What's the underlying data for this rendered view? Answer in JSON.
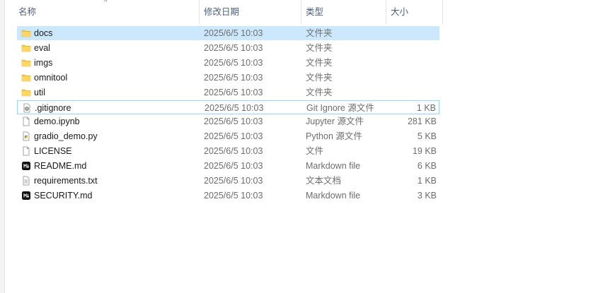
{
  "columns": {
    "name": "名称",
    "modified": "修改日期",
    "type": "类型",
    "size": "大小",
    "sort_indicator": "^"
  },
  "colors": {
    "folder": "#f5c542",
    "selection": "#cce8ff",
    "header_text": "#4c607a",
    "secondary_text": "#6d6d6d"
  },
  "files": [
    {
      "name": "docs",
      "modified": "2025/6/5 10:03",
      "type": "文件夹",
      "size": "",
      "icon": "folder-icon",
      "state": "selected"
    },
    {
      "name": "eval",
      "modified": "2025/6/5 10:03",
      "type": "文件夹",
      "size": "",
      "icon": "folder-icon",
      "state": ""
    },
    {
      "name": "imgs",
      "modified": "2025/6/5 10:03",
      "type": "文件夹",
      "size": "",
      "icon": "folder-icon",
      "state": ""
    },
    {
      "name": "omnitool",
      "modified": "2025/6/5 10:03",
      "type": "文件夹",
      "size": "",
      "icon": "folder-icon",
      "state": ""
    },
    {
      "name": "util",
      "modified": "2025/6/5 10:03",
      "type": "文件夹",
      "size": "",
      "icon": "folder-icon",
      "state": ""
    },
    {
      "name": ".gitignore",
      "modified": "2025/6/5 10:03",
      "type": "Git Ignore 源文件",
      "size": "1 KB",
      "icon": "settings-file-icon",
      "state": "focused"
    },
    {
      "name": "demo.ipynb",
      "modified": "2025/6/5 10:03",
      "type": "Jupyter 源文件",
      "size": "281 KB",
      "icon": "file-icon",
      "state": ""
    },
    {
      "name": "gradio_demo.py",
      "modified": "2025/6/5 10:03",
      "type": "Python 源文件",
      "size": "5 KB",
      "icon": "python-file-icon",
      "state": ""
    },
    {
      "name": "LICENSE",
      "modified": "2025/6/5 10:03",
      "type": "文件",
      "size": "19 KB",
      "icon": "file-icon",
      "state": ""
    },
    {
      "name": "README.md",
      "modified": "2025/6/5 10:03",
      "type": "Markdown file",
      "size": "6 KB",
      "icon": "markdown-icon",
      "state": ""
    },
    {
      "name": "requirements.txt",
      "modified": "2025/6/5 10:03",
      "type": "文本文档",
      "size": "1 KB",
      "icon": "text-file-icon",
      "state": ""
    },
    {
      "name": "SECURITY.md",
      "modified": "2025/6/5 10:03",
      "type": "Markdown file",
      "size": "3 KB",
      "icon": "markdown-icon",
      "state": ""
    }
  ]
}
